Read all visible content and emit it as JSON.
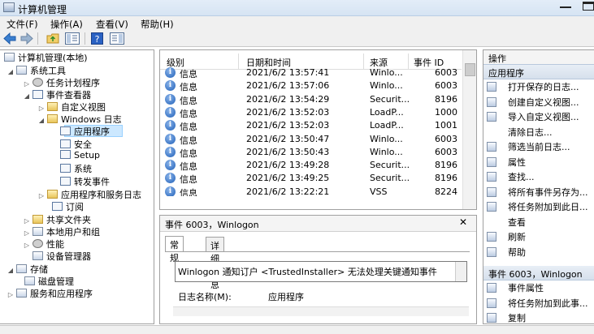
{
  "window": {
    "title": "计算机管理"
  },
  "menu": [
    "文件(F)",
    "操作(A)",
    "查看(V)",
    "帮助(H)"
  ],
  "tree": [
    {
      "label": "计算机管理(本地)"
    },
    {
      "label": "系统工具"
    },
    {
      "label": "任务计划程序"
    },
    {
      "label": "事件查看器"
    },
    {
      "label": "自定义视图"
    },
    {
      "label": "Windows 日志"
    },
    {
      "label": "应用程序"
    },
    {
      "label": "安全"
    },
    {
      "label": "Setup"
    },
    {
      "label": "系统"
    },
    {
      "label": "转发事件"
    },
    {
      "label": "应用程序和服务日志"
    },
    {
      "label": "订阅"
    },
    {
      "label": "共享文件夹"
    },
    {
      "label": "本地用户和组"
    },
    {
      "label": "性能"
    },
    {
      "label": "设备管理器"
    },
    {
      "label": "存储"
    },
    {
      "label": "磁盘管理"
    },
    {
      "label": "服务和应用程序"
    }
  ],
  "events": {
    "columns": [
      "级别",
      "日期和时间",
      "来源",
      "事件 ID"
    ],
    "rows": [
      {
        "level": "信息",
        "datetime": "2021/6/2 13:57:41",
        "source": "Winlo...",
        "id": "6003"
      },
      {
        "level": "信息",
        "datetime": "2021/6/2 13:57:06",
        "source": "Winlo...",
        "id": "6003"
      },
      {
        "level": "信息",
        "datetime": "2021/6/2 13:54:29",
        "source": "Securit...",
        "id": "8196"
      },
      {
        "level": "信息",
        "datetime": "2021/6/2 13:52:03",
        "source": "LoadP...",
        "id": "1000"
      },
      {
        "level": "信息",
        "datetime": "2021/6/2 13:52:03",
        "source": "LoadP...",
        "id": "1001"
      },
      {
        "level": "信息",
        "datetime": "2021/6/2 13:50:47",
        "source": "Winlo...",
        "id": "6003"
      },
      {
        "level": "信息",
        "datetime": "2021/6/2 13:50:43",
        "source": "Winlo...",
        "id": "6003"
      },
      {
        "level": "信息",
        "datetime": "2021/6/2 13:49:28",
        "source": "Securit...",
        "id": "8196"
      },
      {
        "level": "信息",
        "datetime": "2021/6/2 13:49:25",
        "source": "Securit...",
        "id": "8196"
      },
      {
        "level": "信息",
        "datetime": "2021/6/2 13:22:21",
        "source": "VSS",
        "id": "8224"
      }
    ]
  },
  "detail": {
    "title": "事件 6003，Winlogon",
    "tabs": [
      "常规",
      "详细信息"
    ],
    "message": "Winlogon 通知订户 <TrustedInstaller> 无法处理关键通知事件",
    "log_name_label": "日志名称(M):",
    "log_name_value": "应用程序"
  },
  "actions": {
    "section1": "操作",
    "subsection1": "应用程序",
    "items1": [
      "打开保存的日志...",
      "创建自定义视图...",
      "导入自定义视图...",
      "清除日志...",
      "筛选当前日志...",
      "属性",
      "查找...",
      "将所有事件另存为...",
      "将任务附加到此日...",
      "查看",
      "刷新",
      "帮助"
    ],
    "section2": "事件 6003，Winlogon",
    "items2": [
      "事件属性",
      "将任务附加到此事...",
      "复制"
    ]
  }
}
